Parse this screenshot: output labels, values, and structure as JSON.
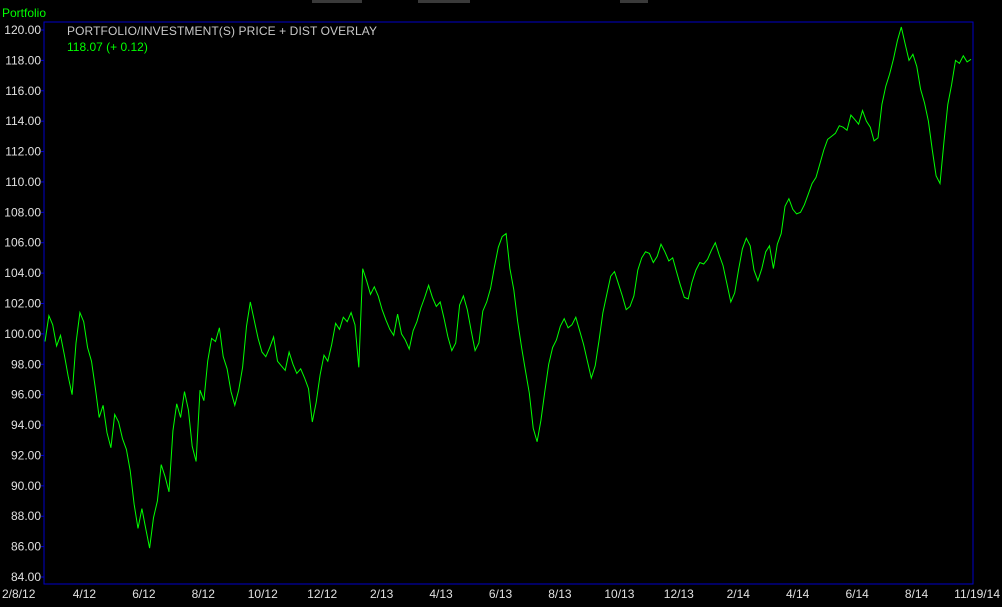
{
  "panel": {
    "label": "Portfolio",
    "overlay_title": "PORTFOLIO/INVESTMENT(S) PRICE + DIST OVERLAY",
    "last_value": "118.07 (+ 0.12)"
  },
  "colors": {
    "line": "#00ff00",
    "frame": "#0000c8",
    "background": "#000000",
    "text": "#e0e0e0"
  },
  "chart_data": {
    "type": "line",
    "title": "PORTFOLIO/INVESTMENT(S) PRICE + DIST OVERLAY",
    "ylim": [
      84,
      120
    ],
    "grid": false,
    "y_ticks": [
      "84.00",
      "86.00",
      "88.00",
      "90.00",
      "92.00",
      "94.00",
      "96.00",
      "98.00",
      "100.00",
      "102.00",
      "104.00",
      "106.00",
      "108.00",
      "110.00",
      "112.00",
      "114.00",
      "116.00",
      "118.00",
      "120.00"
    ],
    "x_ticks": [
      "2/8/12",
      "4/12",
      "6/12",
      "8/12",
      "10/12",
      "12/12",
      "2/13",
      "4/13",
      "6/13",
      "8/13",
      "10/13",
      "12/13",
      "2/14",
      "4/14",
      "6/14",
      "8/14",
      "11/19/14"
    ],
    "series": [
      {
        "values": [
          99.5,
          101.2,
          100.6,
          99.2,
          99.9,
          98.6,
          97.2,
          96.0,
          99.4,
          101.4,
          100.8,
          99.1,
          98.2,
          96.4,
          94.5,
          95.3,
          93.5,
          92.5,
          94.7,
          94.2,
          93.1,
          92.4,
          91.0,
          88.8,
          87.2,
          88.5,
          87.2,
          85.9,
          87.9,
          89.0,
          91.4,
          90.6,
          89.6,
          93.6,
          95.4,
          94.5,
          96.2,
          95.0,
          92.6,
          91.6,
          96.3,
          95.6,
          98.2,
          99.7,
          99.5,
          100.4,
          98.5,
          97.7,
          96.2,
          95.3,
          96.3,
          97.8,
          100.5,
          102.1,
          100.9,
          99.7,
          98.8,
          98.5,
          99.1,
          99.8,
          98.2,
          97.9,
          97.6,
          98.8,
          98.0,
          97.4,
          97.7,
          97.1,
          96.4,
          94.2,
          95.5,
          97.3,
          98.6,
          98.2,
          99.3,
          100.7,
          100.3,
          101.1,
          100.8,
          101.4,
          100.6,
          97.8,
          104.3,
          103.5,
          102.6,
          103.1,
          102.5,
          101.6,
          100.9,
          100.3,
          99.9,
          101.3,
          100.0,
          99.6,
          99.0,
          100.2,
          100.8,
          101.7,
          102.4,
          103.2,
          102.4,
          101.8,
          102.1,
          101.0,
          99.8,
          98.9,
          99.4,
          101.9,
          102.5,
          101.6,
          100.2,
          98.9,
          99.4,
          101.5,
          102.1,
          103.0,
          104.4,
          105.7,
          106.4,
          106.6,
          104.3,
          102.9,
          100.8,
          99.1,
          97.6,
          96.1,
          93.8,
          92.9,
          94.3,
          96.2,
          98.0,
          99.1,
          99.6,
          100.5,
          101.0,
          100.4,
          100.6,
          101.1,
          100.2,
          99.3,
          98.2,
          97.1,
          97.9,
          99.6,
          101.4,
          102.6,
          103.8,
          104.1,
          103.3,
          102.5,
          101.6,
          101.8,
          102.5,
          104.2,
          105.0,
          105.4,
          105.3,
          104.7,
          105.1,
          105.9,
          105.4,
          104.8,
          105.0,
          104.1,
          103.2,
          102.4,
          102.3,
          103.4,
          104.2,
          104.7,
          104.6,
          104.9,
          105.5,
          106.0,
          105.2,
          104.5,
          103.3,
          102.1,
          102.7,
          104.2,
          105.6,
          106.3,
          105.8,
          104.2,
          103.5,
          104.3,
          105.4,
          105.8,
          104.3,
          105.9,
          106.6,
          108.4,
          108.9,
          108.2,
          107.9,
          108.0,
          108.5,
          109.2,
          109.9,
          110.3,
          111.2,
          112.1,
          112.8,
          113.0,
          113.2,
          113.7,
          113.6,
          113.4,
          114.4,
          114.1,
          113.8,
          114.7,
          114.0,
          113.6,
          112.7,
          112.9,
          115.1,
          116.3,
          117.1,
          118.1,
          119.3,
          120.2,
          119.1,
          118.0,
          118.4,
          117.6,
          116.1,
          115.2,
          114.0,
          112.1,
          110.4,
          109.9,
          112.6,
          115.1,
          116.4,
          118.0,
          117.8,
          118.3,
          117.9,
          118.07
        ]
      }
    ]
  }
}
